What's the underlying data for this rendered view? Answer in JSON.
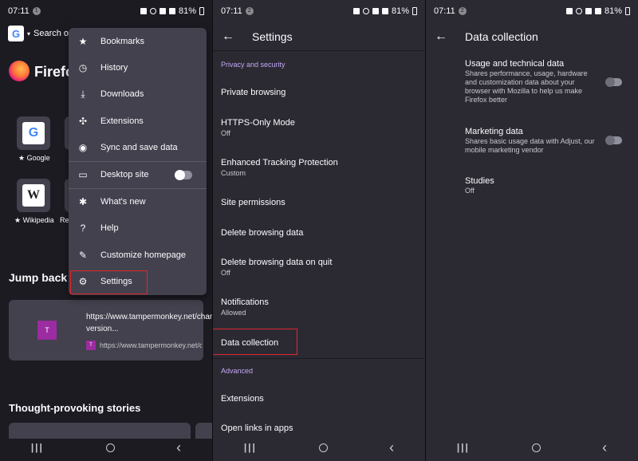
{
  "status": {
    "time": "07:11",
    "battery": "81%"
  },
  "home": {
    "search_placeholder": "Search o",
    "brand": "Firefo",
    "google_letter": "G",
    "wiki_letter": "W",
    "shortcuts": [
      {
        "label": "★ Google"
      },
      {
        "label": "★ Wikipedia"
      },
      {
        "label": "Re"
      }
    ],
    "jump_back": "Jump back i",
    "jump_card": {
      "thumb_letter": "T",
      "title": "https://www.tampermonkey.net/changelog.php?version...",
      "url": "https://www.tampermonkey.net/ch..."
    },
    "thought": "Thought-provoking stories"
  },
  "menu": {
    "items": [
      {
        "label": "Bookmarks",
        "icon": "★"
      },
      {
        "label": "History",
        "icon": "◷"
      },
      {
        "label": "Downloads",
        "icon": "⤓"
      },
      {
        "label": "Extensions",
        "icon": "✣"
      },
      {
        "label": "Sync and save data",
        "icon": "◉"
      },
      {
        "label": "Desktop site",
        "icon": "▭"
      },
      {
        "label": "What's new",
        "icon": "✱"
      },
      {
        "label": "Help",
        "icon": "?"
      },
      {
        "label": "Customize homepage",
        "icon": "✎"
      },
      {
        "label": "Settings",
        "icon": "⚙"
      }
    ]
  },
  "settings": {
    "title": "Settings",
    "section_privacy": "Privacy and security",
    "items": [
      {
        "title": "Private browsing",
        "sub": ""
      },
      {
        "title": "HTTPS-Only Mode",
        "sub": "Off"
      },
      {
        "title": "Enhanced Tracking Protection",
        "sub": "Custom"
      },
      {
        "title": "Site permissions",
        "sub": ""
      },
      {
        "title": "Delete browsing data",
        "sub": ""
      },
      {
        "title": "Delete browsing data on quit",
        "sub": "Off"
      },
      {
        "title": "Notifications",
        "sub": "Allowed"
      },
      {
        "title": "Data collection",
        "sub": ""
      }
    ],
    "section_advanced": "Advanced",
    "advanced_items": [
      {
        "title": "Extensions"
      },
      {
        "title": "Open links in apps"
      }
    ]
  },
  "data_collection": {
    "title": "Data collection",
    "items": [
      {
        "title": "Usage and technical data",
        "sub": "Shares performance, usage, hardware and customization data about your browser with Mozilla to help us make Firefox better"
      },
      {
        "title": "Marketing data",
        "sub": "Shares basic usage data with Adjust, our mobile marketing vendor"
      },
      {
        "title": "Studies",
        "sub": "Off"
      }
    ]
  },
  "nav": {
    "recent": "|||",
    "back": "‹"
  },
  "colors": {
    "accent_purple": "#c2a7f2",
    "highlight_red": "#e0282e",
    "menu_bg": "#42414d"
  }
}
